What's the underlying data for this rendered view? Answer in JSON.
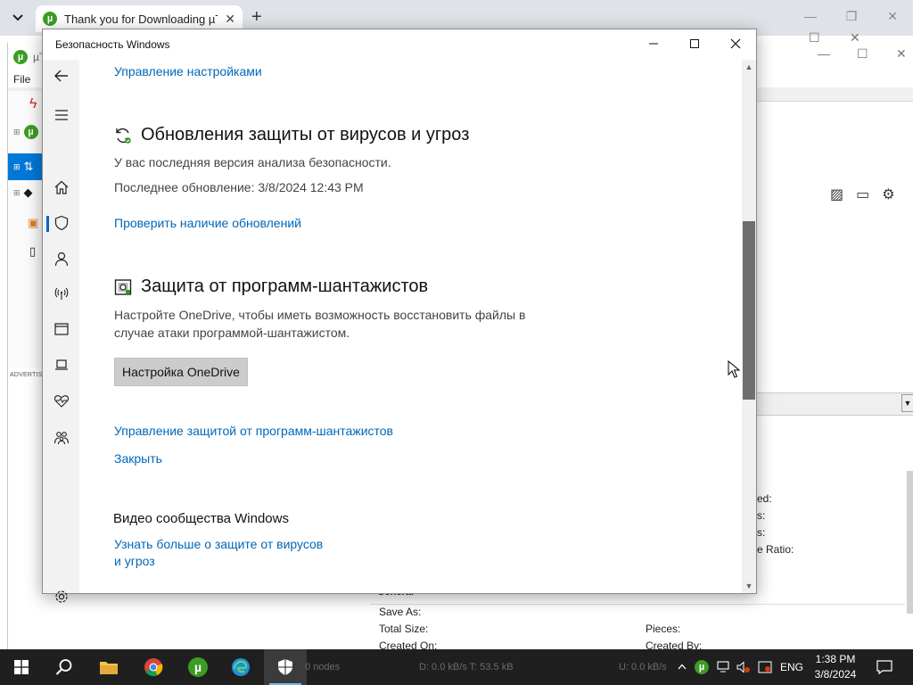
{
  "browser": {
    "tab_title": "Thank you for Downloading µT",
    "tab_close": "✕",
    "new_tab": "+",
    "controls": {
      "minimize": "—",
      "restore": "❐",
      "close": "✕"
    }
  },
  "utorrent": {
    "title": "µT",
    "menu_file": "File",
    "ad_label": "ADVERTISE",
    "right_labels": [
      "ed:",
      "s:",
      "s:",
      "e Ratio:"
    ],
    "general_header": "General",
    "info": {
      "save_as": "Save As:",
      "total_size": "Total Size:",
      "created_on": "Created On:",
      "pieces": "Pieces:",
      "created_by": "Created By:"
    },
    "status_nodes": "0 nodes",
    "status_down": "D: 0.0 kB/s T: 53.5 kB",
    "status_up": "U: 0.0 kB/s"
  },
  "security": {
    "window_title": "Безопасность Windows",
    "controls": {
      "minimize": "—",
      "maximize": "☐",
      "close": "✕"
    },
    "manage_settings_link": "Управление настройками",
    "updates": {
      "heading": "Обновления защиты от вирусов и угроз",
      "latest_text": "У вас последняя версия анализа безопасности.",
      "last_update": "Последнее обновление: 3/8/2024 12:43 PM",
      "check_link": "Проверить наличие обновлений"
    },
    "ransomware": {
      "heading": "Защита от программ-шантажистов",
      "description_line1": "Настройте OneDrive, чтобы иметь возможность восстановить файлы в",
      "description_line2": "случае атаки программой-шантажистом.",
      "setup_button": "Настройка OneDrive",
      "manage_link": "Управление защитой от программ-шантажистов",
      "close_link": "Закрыть"
    },
    "community": {
      "heading": "Видео сообщества Windows",
      "learn_link_line1": "Узнать больше о защите от вирусов",
      "learn_link_line2": "и угроз"
    },
    "nav_icons": [
      "back-icon",
      "menu-icon",
      "home-icon",
      "shield-icon",
      "account-icon",
      "firewall-icon",
      "app-browser-icon",
      "device-security-icon",
      "health-icon",
      "family-icon",
      "settings-icon"
    ]
  },
  "taskbar": {
    "language": "ENG",
    "time": "1:38 PM",
    "date": "3/8/2024",
    "colors": {
      "bg": "#1f1f1f",
      "active_indicator": "#76b9ed"
    }
  },
  "colors": {
    "link": "#0067b8",
    "nav_bg": "#f2f2f2",
    "button_bg": "#cccccc"
  }
}
